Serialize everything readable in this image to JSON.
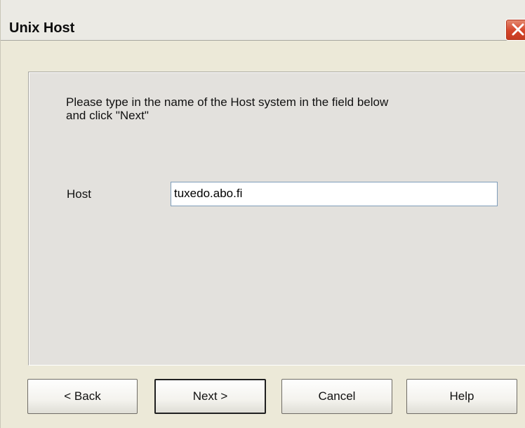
{
  "window": {
    "title": "Unix Host",
    "close_icon": "close-icon"
  },
  "content": {
    "instructions": "Please type in the name of the Host system in the field below\nand click \"Next\"",
    "host_label": "Host",
    "host_value": "tuxedo.abo.fi"
  },
  "buttons": {
    "back": "< Back",
    "next": "Next >",
    "cancel": "Cancel",
    "help": "Help"
  },
  "colors": {
    "close_button": "#d5452a",
    "dialog_background": "#ece9d8"
  }
}
